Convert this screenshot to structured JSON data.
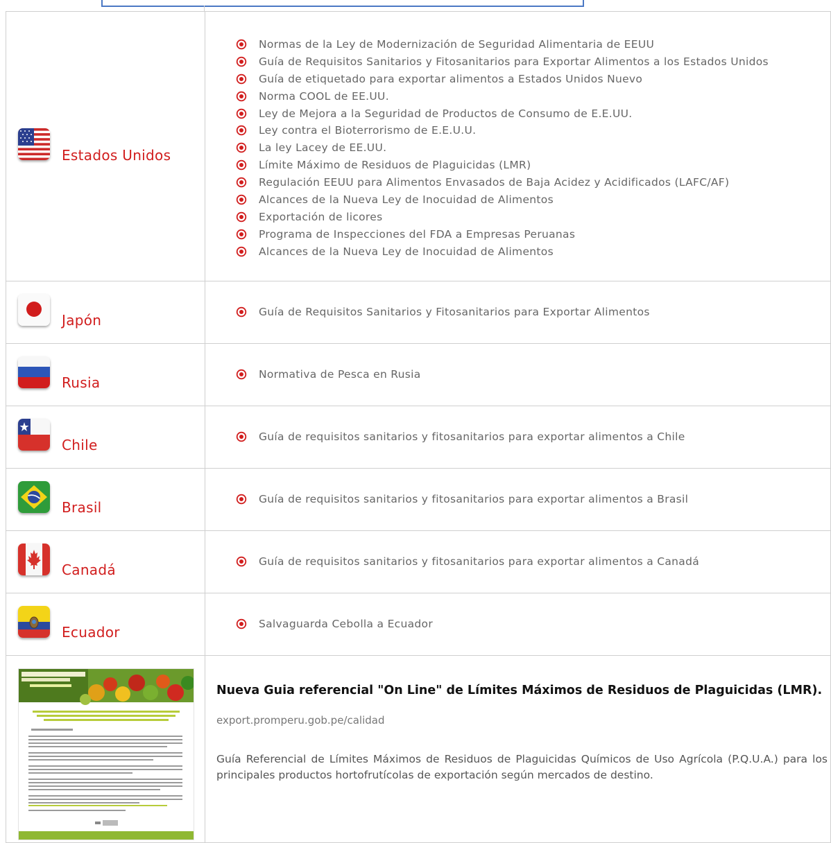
{
  "colors": {
    "country": "#d11d1d",
    "link": "#666666",
    "bullet": "#d11d1d",
    "border": "#cfcfcf",
    "accent_green": "#8fb832"
  },
  "countries": [
    {
      "name": "Estados Unidos",
      "flag_icon": "usa-flag-icon",
      "links": [
        "Normas de la Ley de Modernización de Seguridad Alimentaria de EEUU",
        "Guía de Requisitos Sanitarios y Fitosanitarios para Exportar Alimentos a los Estados Unidos",
        "Guía de etiquetado para exportar alimentos a Estados Unidos Nuevo",
        "Norma COOL de EE.UU.",
        "Ley de Mejora a la Seguridad de Productos de Consumo de E.E.UU.",
        "Ley contra el Bioterrorismo de E.E.U.U.",
        "La ley Lacey de EE.UU.",
        "Límite Máximo de Residuos de Plaguicidas (LMR)",
        "Regulación EEUU para Alimentos Envasados de Baja Acidez y Acidificados (LAFC/AF)",
        "Alcances de la Nueva Ley de Inocuidad de Alimentos",
        "Exportación de licores",
        "Programa de Inspecciones del FDA a Empresas Peruanas",
        "Alcances de la Nueva Ley de Inocuidad de Alimentos"
      ]
    },
    {
      "name": "Japón",
      "flag_icon": "japan-flag-icon",
      "links": [
        "Guía de Requisitos Sanitarios y Fitosanitarios para Exportar Alimentos"
      ]
    },
    {
      "name": "Rusia",
      "flag_icon": "russia-flag-icon",
      "links": [
        "Normativa de Pesca en Rusia"
      ]
    },
    {
      "name": "Chile",
      "flag_icon": "chile-flag-icon",
      "links": [
        "Guía de requisitos sanitarios y fitosanitarios para exportar alimentos a Chile"
      ]
    },
    {
      "name": "Brasil",
      "flag_icon": "brazil-flag-icon",
      "links": [
        "Guía de requisitos sanitarios y fitosanitarios para exportar alimentos a Brasil"
      ]
    },
    {
      "name": "Canadá",
      "flag_icon": "canada-flag-icon",
      "links": [
        "Guía de requisitos sanitarios y fitosanitarios para exportar alimentos a Canadá"
      ]
    },
    {
      "name": "Ecuador",
      "flag_icon": "ecuador-flag-icon",
      "links": [
        "Salvaguarda Cebolla a Ecuador"
      ]
    }
  ],
  "promo": {
    "title": "Nueva Guia referencial \"On Line\" de Límites Máximos de Residuos de Plaguicidas (LMR).",
    "url": "export.promperu.gob.pe/calidad",
    "description": "Guía Referencial de Límites Máximos de Residuos de Plaguicidas Químicos de Uso Agrícola (P.Q.U.A.) para los principales productos hortofrutícolas de exportación según mercados de destino."
  }
}
